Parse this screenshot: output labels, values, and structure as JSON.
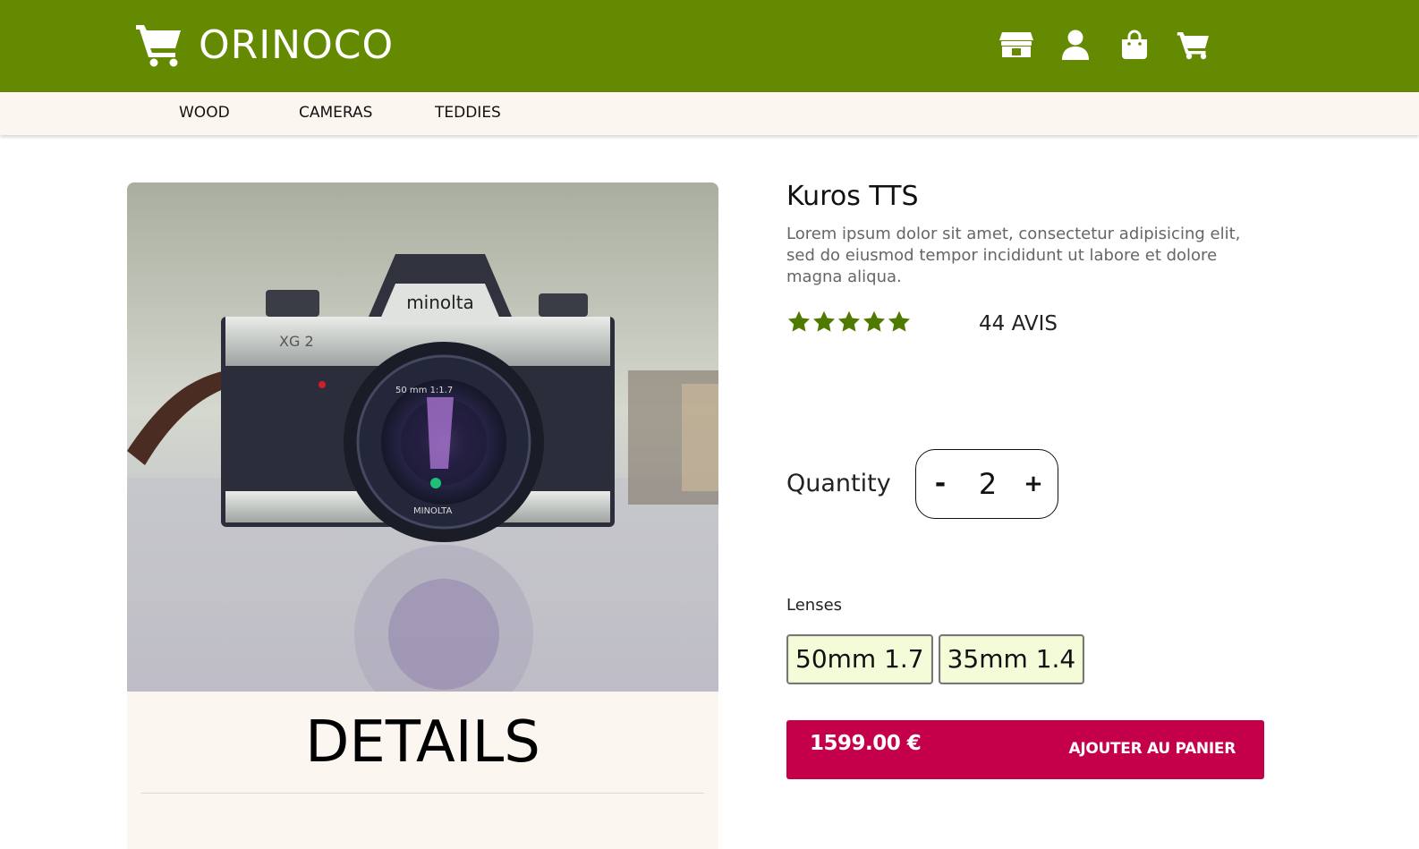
{
  "header": {
    "brand_name": "ORINOCO",
    "icons": [
      "shop-icon",
      "user-icon",
      "shopping-bag-icon",
      "cart-icon"
    ],
    "brand_color": "#638a00"
  },
  "categories": [
    {
      "label": "WOOD"
    },
    {
      "label": "CAMERAS"
    },
    {
      "label": "TEDDIES"
    }
  ],
  "product": {
    "title": "Kuros TTS",
    "description": "Lorem ipsum dolor sit amet, consectetur adipisicing elit, sed do eiusmod tempor incididunt ut labore et dolore magna aliqua.",
    "rating": 5,
    "rating_max": 5,
    "reviews": "44 AVIS",
    "image_alt": "minolta"
  },
  "quantity": {
    "label": "Quantity",
    "minus": "-",
    "value": "2",
    "plus": "+"
  },
  "lenses": {
    "label": "Lenses",
    "options": [
      "50mm 1.7",
      "35mm 1.4"
    ]
  },
  "purchase": {
    "price": "1599.00 €",
    "button_label": "AJOUTER AU PANIER",
    "button_color": "#c4004b"
  },
  "details": {
    "title": "DETAILS"
  }
}
